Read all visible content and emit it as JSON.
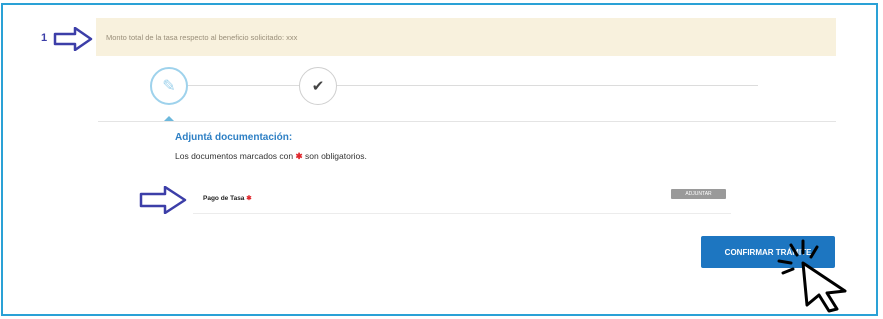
{
  "banner": {
    "step_number": "1",
    "text": "Monto total de la tasa respecto al beneficio solicitado: xxx"
  },
  "stepper": {
    "steps": [
      {
        "icon": "paperclip-icon",
        "glyph": "✎",
        "state": "active"
      },
      {
        "icon": "checkmark-icon",
        "glyph": "✔",
        "state": "pending"
      }
    ]
  },
  "documents": {
    "title": "Adjuntá documentación:",
    "description_prefix": "Los documentos marcados con",
    "description_suffix": "son obligatorios.",
    "required_marker": "✱",
    "items": [
      {
        "label": "Pago de Tasa",
        "required": true,
        "button_label": "ADJUNTAR"
      }
    ]
  },
  "actions": {
    "confirm_label": "CONFIRMAR TRÁMITE"
  },
  "colors": {
    "frame": "#2aa1d6",
    "banner_bg": "#f8f1dd",
    "accent": "#1d76c1",
    "annotation_arrow": "#3c3ea8",
    "required": "#e0262b"
  }
}
